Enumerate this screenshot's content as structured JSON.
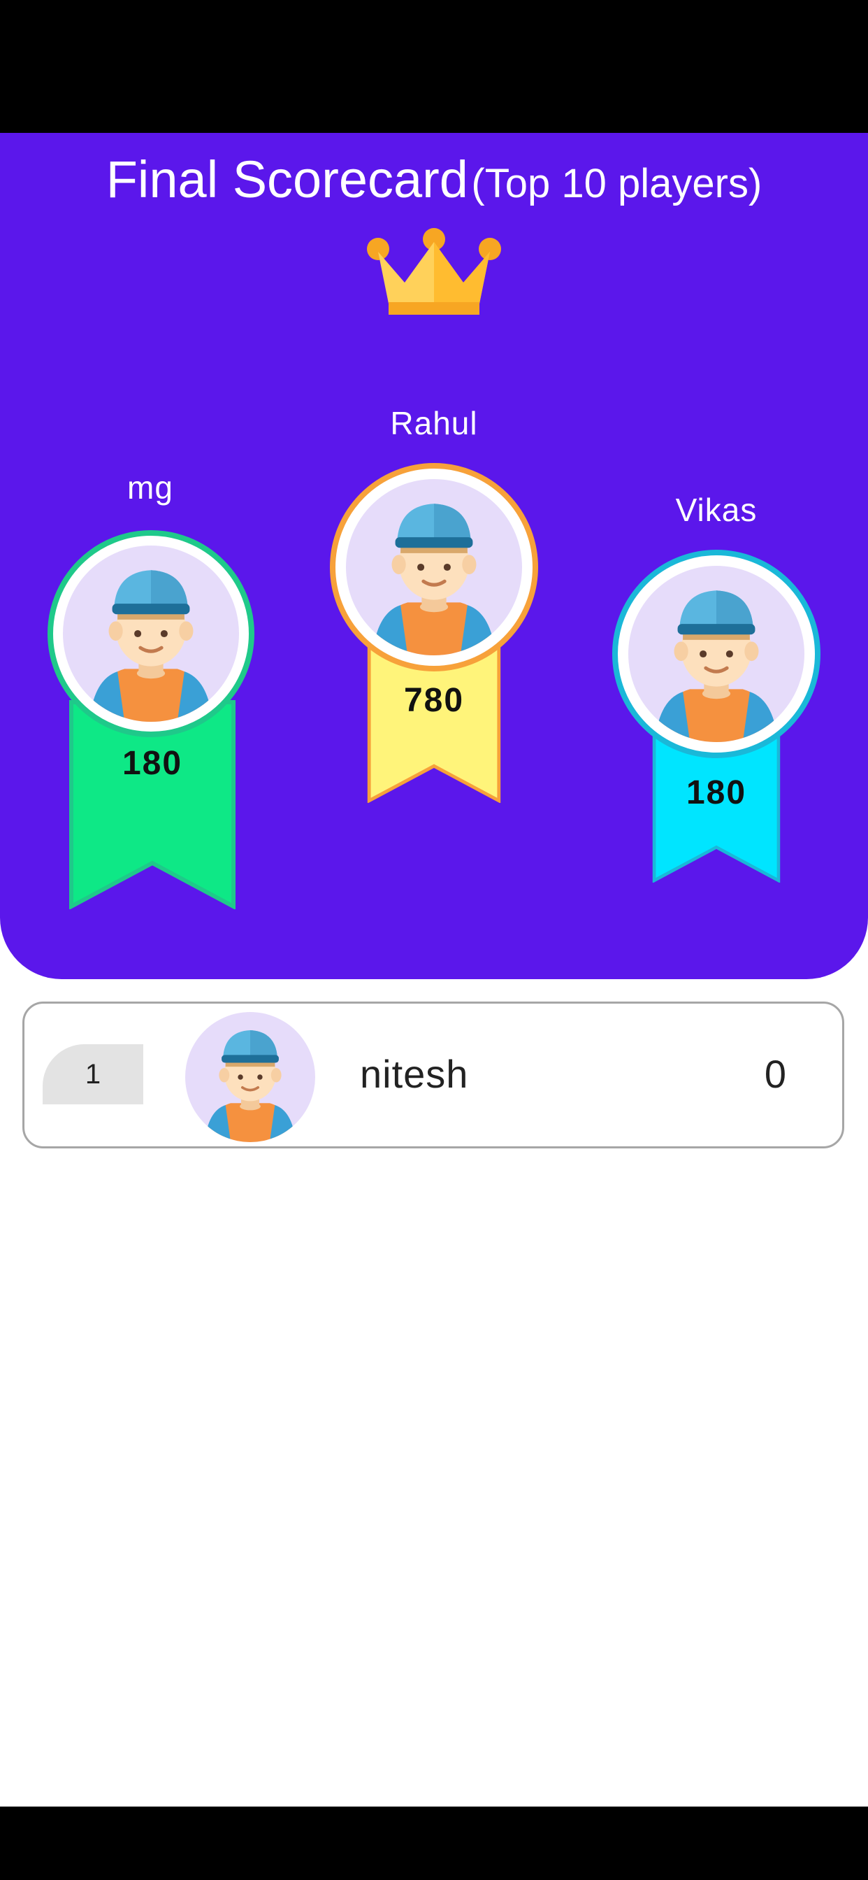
{
  "header": {
    "title": "Final Scorecard",
    "subtitle": "(Top 10 players)"
  },
  "podium": [
    {
      "name": "mg",
      "score": "180",
      "place": 2,
      "ribbon_color": "#0ee886",
      "ring_color": "#1fc98a"
    },
    {
      "name": "Rahul",
      "score": "780",
      "place": 1,
      "ribbon_color": "#fff47a",
      "ring_color": "#f7a13a"
    },
    {
      "name": "Vikas",
      "score": "180",
      "place": 3,
      "ribbon_color": "#00e5ff",
      "ring_color": "#1ab8d8"
    }
  ],
  "leaderboard": [
    {
      "rank": "1",
      "name": "nitesh",
      "score": "0"
    }
  ],
  "colors": {
    "header_bg": "#5b17eb",
    "crown": "#ffc12e"
  },
  "icons": {
    "crown": "crown-icon",
    "avatar": "avatar-icon"
  }
}
